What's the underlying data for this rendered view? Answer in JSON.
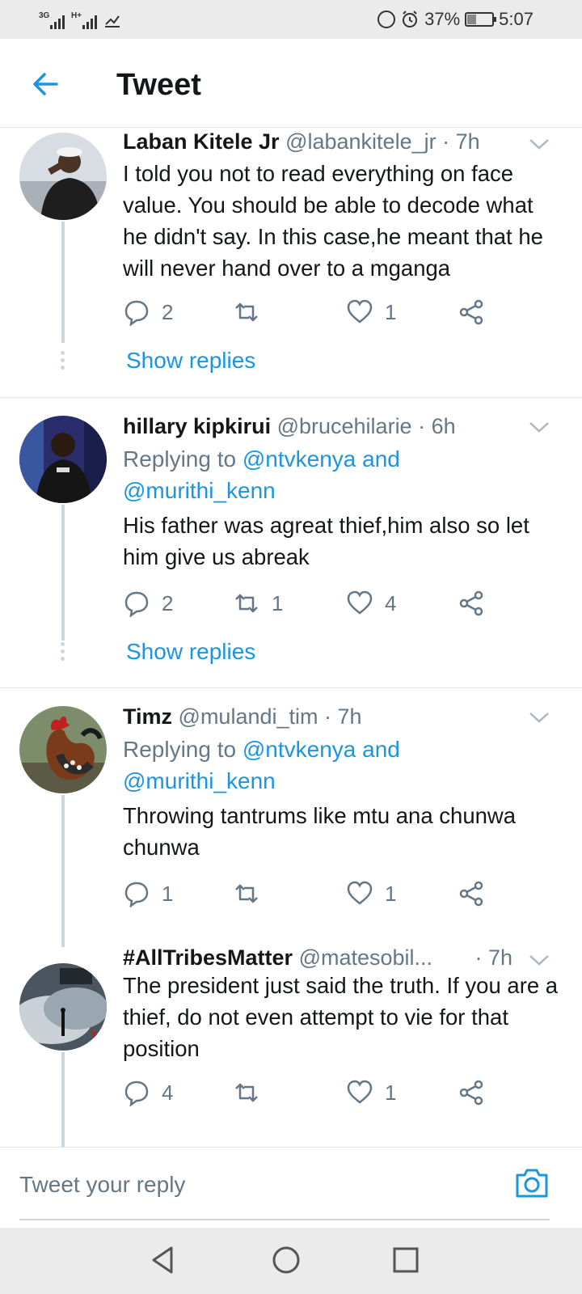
{
  "status_bar": {
    "signal1_tag": "3G",
    "signal2_tag": "H+",
    "battery": "37%",
    "battery_level": 0.37,
    "time": "5:07"
  },
  "header": {
    "title": "Tweet",
    "back_icon": "arrow-left-icon"
  },
  "tweets": [
    {
      "name": "Laban Kitele Jr",
      "handle": "@labankitele_jr",
      "time": "· 7h",
      "replying_to": null,
      "text": "I told you not to read everything on face value. You should be able to decode what he didn't say. In this case,he meant that he will never hand over to a mganga",
      "replies": "2",
      "retweets": "",
      "likes": "1",
      "show_replies": "Show replies"
    },
    {
      "name": "hillary kipkirui",
      "handle": "@brucehilarie",
      "time": "· 6h",
      "replying_prefix": "Replying to",
      "replying_to_1": "@ntvkenya and",
      "replying_to_2": "@murithi_kenn",
      "text": "His father was agreat thief,him also so let him give us abreak",
      "replies": "2",
      "retweets": "1",
      "likes": "4",
      "show_replies": "Show replies"
    },
    {
      "name": "Timz",
      "handle": "@mulandi_tim",
      "time": "· 7h",
      "replying_prefix": "Replying to",
      "replying_to_1": "@ntvkenya and",
      "replying_to_2": "@murithi_kenn",
      "text": "Throwing tantrums like mtu ana chunwa chunwa",
      "replies": "1",
      "retweets": "",
      "likes": "1"
    },
    {
      "name": "#AllTribesMatter",
      "handle": "@matesobil...",
      "time": "· 7h",
      "text": "The president just said the truth. If you are a thief, do not even attempt to vie for that position",
      "replies": "4",
      "retweets": "",
      "likes": "1"
    }
  ],
  "compose": {
    "placeholder": "Tweet your reply",
    "camera_icon": "camera-icon"
  },
  "colors": {
    "accent": "#1b95e0",
    "secondary_text": "#657786",
    "primary_text": "#14171a",
    "divider": "#e1e8ed"
  }
}
